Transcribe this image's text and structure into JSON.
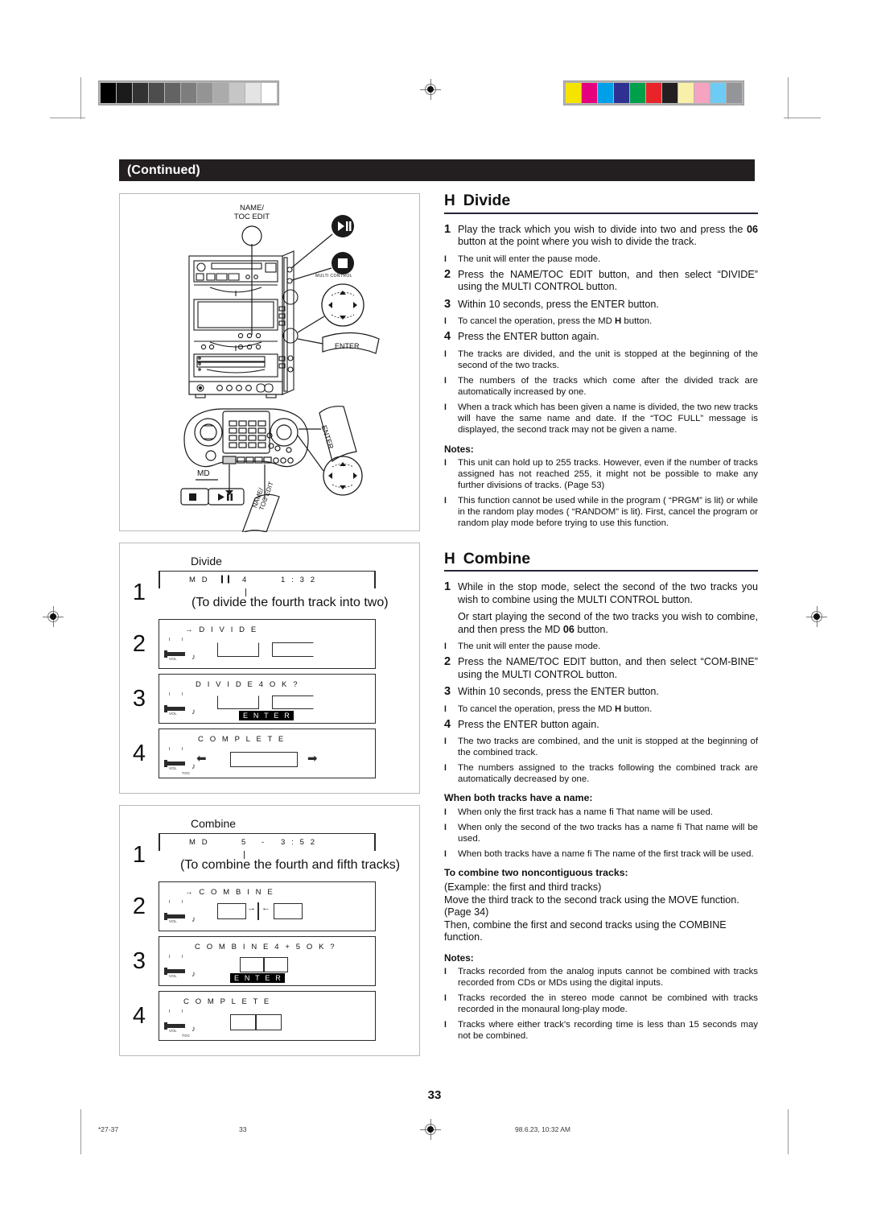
{
  "header": {
    "continued_label": "(Continued)"
  },
  "page_footer": {
    "page_number": "33",
    "signature": "*27-37",
    "folio": "33",
    "timestamp": "98.6.23, 10:32 AM"
  },
  "calibration": {
    "gray_swatches": [
      "#000000",
      "#1b1b1b",
      "#333333",
      "#4d4d4d",
      "#636363",
      "#7d7d7d",
      "#949494",
      "#ababab",
      "#c6c6c6",
      "#e4e4e4",
      "#ffffff"
    ],
    "color_swatches": [
      "#f5e400",
      "#e5007e",
      "#00a0e9",
      "#2e3192",
      "#00a04b",
      "#e8232a",
      "#231f20",
      "#f8f0a8",
      "#f5a3c0",
      "#6ecbf3",
      "#939598"
    ]
  },
  "illustration": {
    "labels": {
      "name_toc_edit": "NAME/\nTOC EDIT",
      "name_toc_edit_line1": "NAME/",
      "name_toc_edit_line2": "TOC EDIT",
      "multi_control": "MULTI CONTROL",
      "enter": "ENTER",
      "md": "MD",
      "remote_enter": "ENTER",
      "remote_name_toc_edit_line1": "NAME/",
      "remote_name_toc_edit_line2": "TOC EDIT",
      "play_pause_symbol": "▶❙❙",
      "stop_symbol": "■"
    }
  },
  "divide_section": {
    "glyph": "H",
    "title": "Divide",
    "steps": [
      {
        "num": "1",
        "text_pre": "Play the track which you wish to divide into two and press the ",
        "bold": "06",
        "text_post": "  button at the point where you wish to divide the track."
      },
      {
        "num": "2",
        "text": "Press the NAME/TOC EDIT button, and then select “DIVIDE” using the MULTI CONTROL button."
      },
      {
        "num": "3",
        "text": "Within 10 seconds, press the ENTER button."
      },
      {
        "num": "4",
        "text": "Press the ENTER button again."
      }
    ],
    "bullet_after_1": "The unit will enter the pause mode.",
    "bullet_after_3_pre": "To cancel the operation, press the MD ",
    "bullet_after_3_bold": "H",
    "bullet_after_3_post": " button.",
    "bullets_after_4": [
      "The tracks are divided, and the unit is stopped at the beginning of the second of the two tracks.",
      "The numbers of the tracks which come after the divided track are automatically increased by one.",
      "When a track which has been given a name is divided, the two new tracks will have the same name and date. If the “TOC FULL” message is displayed, the second track may not be given a name."
    ],
    "notes_label": "Notes:",
    "notes": [
      "This unit can hold up to 255 tracks. However, even if the number of tracks assigned has not reached 255, it might not be possible to make any further divisions of tracks. (Page 53)",
      "This function cannot be used while in the program ( “PRGM” is lit) or while in the random play modes ( “RANDOM”  is lit). First, cancel the program or random play mode before trying to use this function."
    ]
  },
  "combine_section": {
    "glyph": "H",
    "title": "Combine",
    "steps": [
      {
        "num": "1",
        "text": "While in the stop mode, select the second of the two tracks you wish to combine using the MULTI CONTROL button."
      },
      {
        "num": "2",
        "text": "Press the NAME/TOC EDIT button, and then select “COM-BINE” using the MULTI CONTROL button."
      },
      {
        "num": "3",
        "text": "Within 10 seconds, press the ENTER button."
      },
      {
        "num": "4",
        "text": "Press the ENTER button again."
      }
    ],
    "step1_alt_pre": "Or start playing the second of the two tracks you wish to combine, and then press the MD ",
    "step1_alt_bold": "06",
    "step1_alt_post": "  button.",
    "bullet_after_1": "The unit will enter the pause mode.",
    "bullet_after_3_pre": "To cancel the operation, press the MD ",
    "bullet_after_3_bold": "H",
    "bullet_after_3_post": " button.",
    "bullets_after_4": [
      "The two tracks are combined, and the unit is stopped at the beginning of the combined track.",
      "The numbers assigned to the tracks following the combined track are automatically decreased by one."
    ],
    "name_subhead": "When both tracks have a name:",
    "name_bullets": [
      "When only the first track has a name fi   That name will be used.",
      "When only the second of the two tracks has a name fi   That name will be used.",
      "When both tracks have a name fi   The name of the first track will be used."
    ],
    "noncontiguous_subhead": "To combine two noncontiguous tracks:",
    "noncontiguous_lines": [
      "(Example: the first and third tracks)",
      "Move the third track to the second track using the MOVE function. (Page 34)",
      "Then, combine the first and second tracks using the COMBINE function."
    ],
    "notes_label": "Notes:",
    "notes": [
      "Tracks recorded from the analog inputs cannot be combined with tracks recorded from CDs or MDs using the digital inputs.",
      "Tracks recorded the in stereo mode cannot be combined with tracks recorded in the monaural long-play mode.",
      "Tracks where either track’s recording time is less than 15 seconds may not be combined."
    ]
  },
  "divide_sequence": {
    "title": "Divide",
    "steps": [
      {
        "num": "1",
        "display": "MD  ❙❙    4         1 : 3 2",
        "display_md": "M D",
        "display_pause": "❙❙",
        "display_track": "4",
        "display_time": "1 : 3 2",
        "caption": "(To divide the fourth track into two)"
      },
      {
        "num": "2",
        "display": "→   D I V I D E"
      },
      {
        "num": "3",
        "display": "D I V I D E        4   O K ?",
        "enter_chip": "E N T E R"
      },
      {
        "num": "4",
        "display": "C O M P L E T E"
      }
    ],
    "vol_label": "VOL",
    "toc_label": "TOC"
  },
  "combine_sequence": {
    "title": "Combine",
    "steps": [
      {
        "num": "1",
        "display_md": "M D",
        "display_track": "5",
        "display_dash": "-",
        "display_time": "3 : 5 2",
        "caption": "(To combine the fourth and fifth tracks)"
      },
      {
        "num": "2",
        "display": "→   C O M B I N E"
      },
      {
        "num": "3",
        "display": "C O M B I N E     4 +     5     O K ?",
        "enter_chip": "E N T E R"
      },
      {
        "num": "4",
        "display": "C O M P L E T E"
      }
    ],
    "vol_label": "VOL",
    "toc_label": "TOC"
  }
}
